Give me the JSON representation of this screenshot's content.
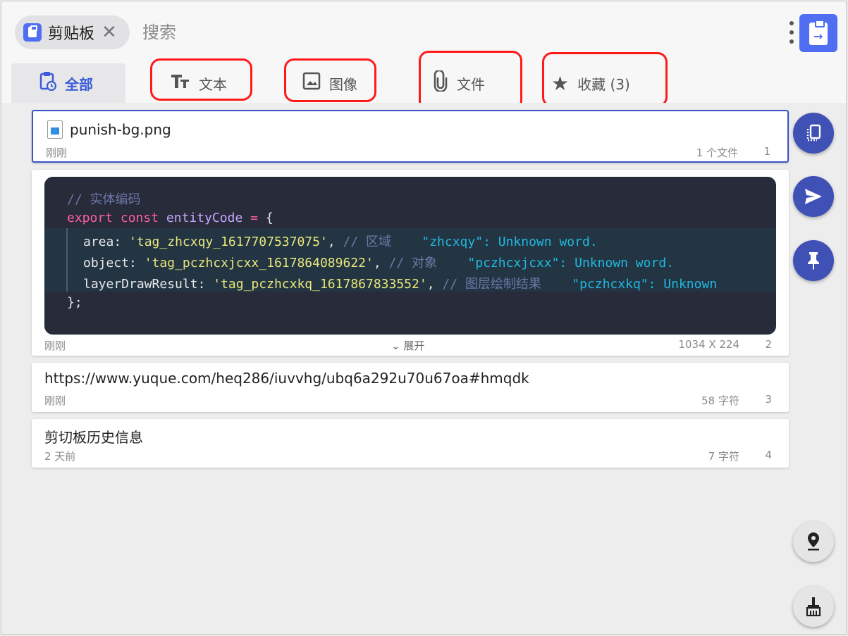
{
  "header": {
    "chip_label": "剪贴板",
    "chip_close": "✕",
    "search_placeholder": "搜索"
  },
  "tabs": [
    {
      "label": "全部",
      "icon": "clipboard-clock-icon",
      "active": true
    },
    {
      "label": "文本",
      "icon": "text-icon",
      "active": false
    },
    {
      "label": "图像",
      "icon": "image-icon",
      "active": false
    },
    {
      "label": "文件",
      "icon": "paperclip-icon",
      "active": false
    },
    {
      "label": "收藏 (3)",
      "icon": "star-icon",
      "active": false
    }
  ],
  "items": [
    {
      "title": "punish-bg.png",
      "time": "刚刚",
      "info": "1 个文件",
      "index": "1"
    },
    {
      "time": "刚刚",
      "expand": "展开",
      "info": "1034 X 224",
      "index": "2",
      "code": {
        "comment": "// 实体编码",
        "line2": {
          "kw1": "export",
          "kw2": "const",
          "id": "entityCode",
          "eq": "=",
          "brace": "{"
        },
        "line3": {
          "prop": "area",
          "val": "'tag_zhcxqy_1617707537075'",
          "comment": "// 区域",
          "warn": "\"zhcxqy\": Unknown word."
        },
        "line4": {
          "prop": "object",
          "val": "'tag_pczhcxjcxx_1617864089622'",
          "comment": "// 对象",
          "warn": "\"pczhcxjcxx\": Unknown word."
        },
        "line5": {
          "prop": "layerDrawResult",
          "val": "'tag_pczhcxkq_1617867833552'",
          "comment": "// 图层绘制结果",
          "warn": "\"pczhcxkq\": Unknown"
        },
        "line6": "};"
      }
    },
    {
      "title": "https://www.yuque.com/heq286/iuvvhg/ubq6a292u70u67oa#hmqdk",
      "time": "刚刚",
      "info": "58 字符",
      "index": "3"
    },
    {
      "title": "剪切板历史信息",
      "time": "2 天前",
      "info": "7 字符",
      "index": "4"
    }
  ],
  "colors": {
    "accent": "#3f51b5",
    "highlight_ring": "#ff1a1a",
    "brand": "#4f6ef2"
  }
}
